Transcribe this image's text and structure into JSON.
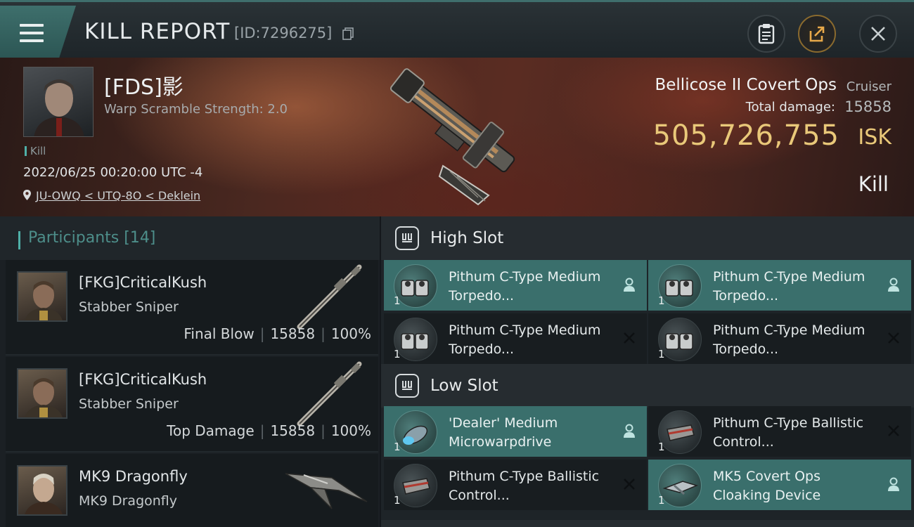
{
  "header": {
    "title": "KILL REPORT",
    "report_id": "[ID:7296275]"
  },
  "victim": {
    "name": "[FDS]影",
    "warp_scramble": "Warp Scramble Strength: 2.0",
    "tag": "Kill",
    "datetime": "2022/06/25 00:20:00 UTC -4",
    "location": "JU-OWQ < UTQ-8O < Deklein",
    "ship_name": "Bellicose II Covert Ops",
    "ship_class": "Cruiser",
    "total_damage_label": "Total damage:",
    "total_damage": "15858",
    "isk_value": "505,726,755",
    "isk_unit": "ISK",
    "result": "Kill"
  },
  "participants": {
    "title": "Participants",
    "count": "[14]",
    "rows": [
      {
        "name": "[FKG]CriticalKush",
        "ship": "Stabber Sniper",
        "role": "Final Blow",
        "damage": "15858",
        "percent": "100%"
      },
      {
        "name": "[FKG]CriticalKush",
        "ship": "Stabber Sniper",
        "role": "Top Damage",
        "damage": "15858",
        "percent": "100%"
      },
      {
        "name": "MK9 Dragonfly",
        "ship": "MK9 Dragonfly"
      }
    ]
  },
  "fitting": {
    "high_slot": {
      "title": "High Slot",
      "items": [
        {
          "name": "Pithum C-Type Medium Torpedo...",
          "qty": "1",
          "status": "dropped"
        },
        {
          "name": "Pithum C-Type Medium Torpedo...",
          "qty": "1",
          "status": "dropped"
        },
        {
          "name": "Pithum C-Type Medium Torpedo...",
          "qty": "1",
          "status": "destroyed"
        },
        {
          "name": "Pithum C-Type Medium Torpedo...",
          "qty": "1",
          "status": "destroyed"
        }
      ]
    },
    "low_slot": {
      "title": "Low Slot",
      "items": [
        {
          "name": "'Dealer' Medium Microwarpdrive",
          "qty": "1",
          "status": "dropped"
        },
        {
          "name": "Pithum C-Type Ballistic Control...",
          "qty": "1",
          "status": "destroyed"
        },
        {
          "name": "Pithum C-Type Ballistic Control...",
          "qty": "1",
          "status": "destroyed"
        },
        {
          "name": "MK5 Covert Ops Cloaking Device",
          "qty": "1",
          "status": "dropped"
        }
      ]
    }
  },
  "colors": {
    "accent_teal": "#3a6f6c",
    "isk_gold": "#e9c879",
    "participants_title": "#4d8e8a"
  },
  "icons": {
    "menu": "hamburger-icon",
    "copy": "copy-icon",
    "clipboard": "clipboard-icon",
    "share": "share-icon",
    "close": "close-icon",
    "location": "location-pin-icon",
    "slot_section": "shield-slot-icon",
    "dropped": "person-icon",
    "destroyed": "x-icon"
  }
}
